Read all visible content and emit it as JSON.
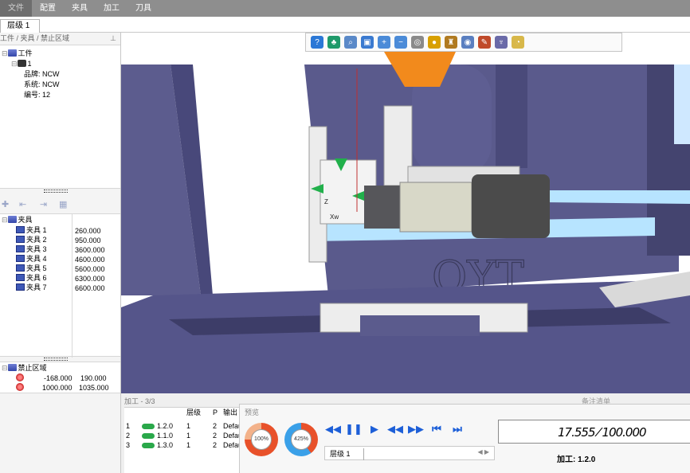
{
  "menu": [
    "文件",
    "配置",
    "夹具",
    "加工",
    "刀具"
  ],
  "tabs": {
    "level_tab": "层级 1"
  },
  "workpiece_panel": {
    "title": "工件 / 夹具 / 禁止区域",
    "root": "工件",
    "item": "1",
    "props": [
      "品牌: NCW",
      "系统: NCW",
      "编号: 12"
    ]
  },
  "fixture_panel": {
    "root": "夹具",
    "items": [
      {
        "name": "夹具 1",
        "value": "260.000"
      },
      {
        "name": "夹具 2",
        "value": "950.000"
      },
      {
        "name": "夹具 3",
        "value": "3600.000"
      },
      {
        "name": "夹具 4",
        "value": "4600.000"
      },
      {
        "name": "夹具 5",
        "value": "5600.000"
      },
      {
        "name": "夹具 6",
        "value": "6300.000"
      },
      {
        "name": "夹具 7",
        "value": "6600.000"
      }
    ]
  },
  "forbidden_panel": {
    "root": "禁止区域",
    "rows": [
      {
        "a": "-168.000",
        "b": "190.000"
      },
      {
        "a": "1000.000",
        "b": "1035.000"
      }
    ]
  },
  "viewport": {
    "logo_text": "OYT",
    "axis_labels": [
      "Z",
      "Xw"
    ]
  },
  "process": {
    "label": "加工 - 3/3",
    "headers": [
      "层级",
      "P",
      "输出"
    ],
    "rows": [
      {
        "n": "1",
        "op": "1.2.0",
        "level": "1",
        "p": "2",
        "out": "Defau"
      },
      {
        "n": "2",
        "op": "1.1.0",
        "level": "1",
        "p": "2",
        "out": "Defau"
      },
      {
        "n": "3",
        "op": "1.3.0",
        "level": "1",
        "p": "2",
        "out": "Defau"
      }
    ]
  },
  "remark": {
    "label": "备注清单"
  },
  "preview": {
    "title": "预览",
    "speed_dial": "100%",
    "feed_dial": "425%",
    "tab": "层级 1",
    "time": "17.555 ⁄ 100.000",
    "status": "加工: 1.2.0"
  },
  "colors": {
    "machine": "#5a5a8c",
    "machine_dark": "#3e3e66",
    "rail": "#b7e4ff",
    "part": "#e6e6e6",
    "orange": "#f28a1c"
  }
}
